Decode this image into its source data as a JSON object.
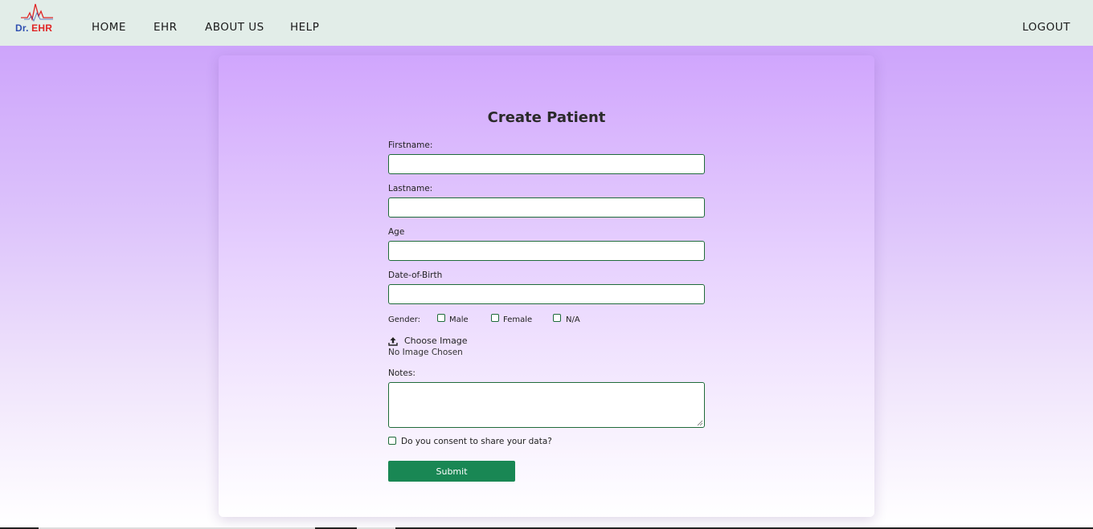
{
  "nav": {
    "logo_prefix": "Dr.",
    "logo_suffix": "EHR",
    "links": [
      "HOME",
      "EHR",
      "ABOUT US",
      "HELP"
    ],
    "logout": "LOGOUT"
  },
  "form": {
    "title": "Create Patient",
    "firstname_label": "Firstname:",
    "firstname_value": "",
    "lastname_label": "Lastname:",
    "lastname_value": "",
    "age_label": "Age",
    "age_value": "",
    "dob_label": "Date-of-Birth",
    "dob_value": "",
    "gender_label": "Gender:",
    "gender_options": [
      "Male",
      "Female",
      "N/A"
    ],
    "choose_image": "Choose Image",
    "no_image": "No Image Chosen",
    "notes_label": "Notes:",
    "notes_value": "",
    "consent_label": "Do you consent to share your data?",
    "submit": "Submit"
  },
  "colors": {
    "nav_bg": "#e2ede8",
    "accent_green": "#198754",
    "input_border": "#1f6b3a",
    "logo_red": "#e02525",
    "logo_blue": "#2f4fb0"
  },
  "icons": [
    "logo-heartbeat-icon",
    "upload-icon",
    "resize-handle-icon"
  ]
}
